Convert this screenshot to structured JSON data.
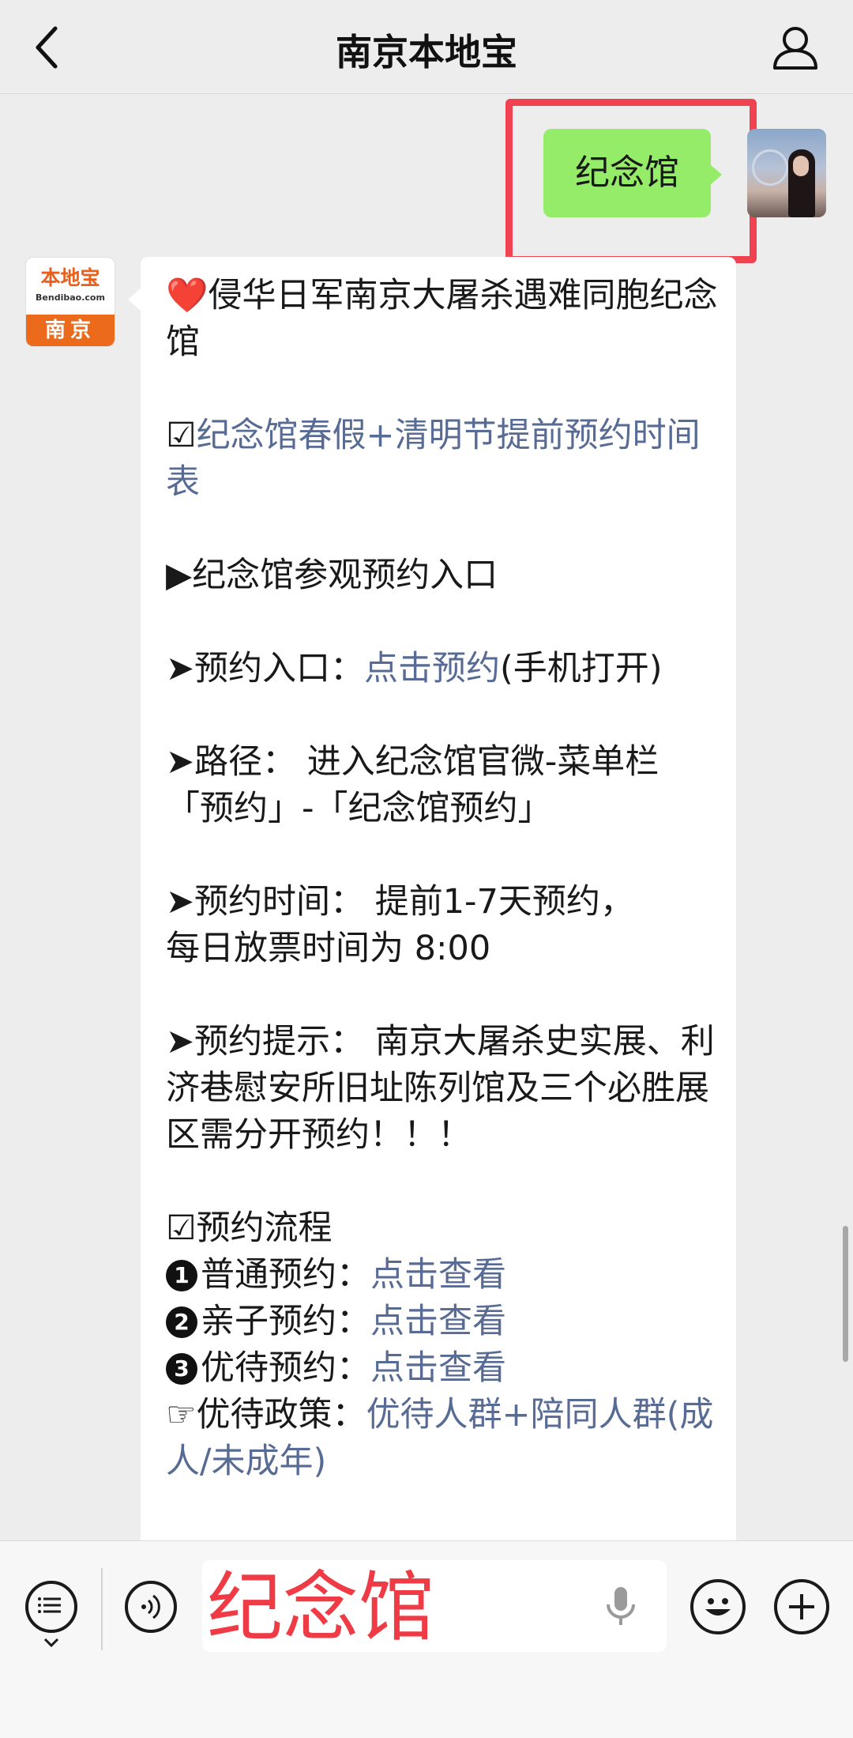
{
  "header": {
    "title": "南京本地宝"
  },
  "outgoing": {
    "text": "纪念馆"
  },
  "bot_avatar": {
    "brand": "本地宝",
    "url": "Bendibao.com",
    "city": "南京"
  },
  "message": {
    "heart": "❤️",
    "title": "侵华日军南京大屠杀遇难同胞纪念馆",
    "schedule_prefix": "☑",
    "schedule_link": "纪念馆春假+清明节提前预约时间表",
    "entry_heading": "▶纪念馆参观预约入口",
    "entry_prefix": "➤预约入口：",
    "entry_link": "点击预约",
    "entry_suffix": "(手机打开)",
    "path": "➤路径： 进入纪念馆官微-菜单栏「预约」-「纪念馆预约」",
    "time_line1": "➤预约时间： 提前1-7天预约，",
    "time_line2": "每日放票时间为 8:00",
    "tip": "➤预约提示： 南京大屠杀史实展、利济巷慰安所旧址陈列馆及三个必胜展区需分开预约！！！",
    "flow_heading": "☑预约流程",
    "flow": [
      {
        "num": "1",
        "label": "普通预约：",
        "link": "点击查看"
      },
      {
        "num": "2",
        "label": "亲子预约：",
        "link": "点击查看"
      },
      {
        "num": "3",
        "label": "优待预约：",
        "link": "点击查看"
      }
    ],
    "policy_prefix": "☞优待政策：",
    "policy_link": "优待人群+陪同人群(成人/未成年)"
  },
  "input": {
    "value": "纪念馆"
  },
  "colors": {
    "accent_highlight": "#ef4352",
    "link": "#576b95",
    "outgoing_bubble": "#95ec69"
  }
}
